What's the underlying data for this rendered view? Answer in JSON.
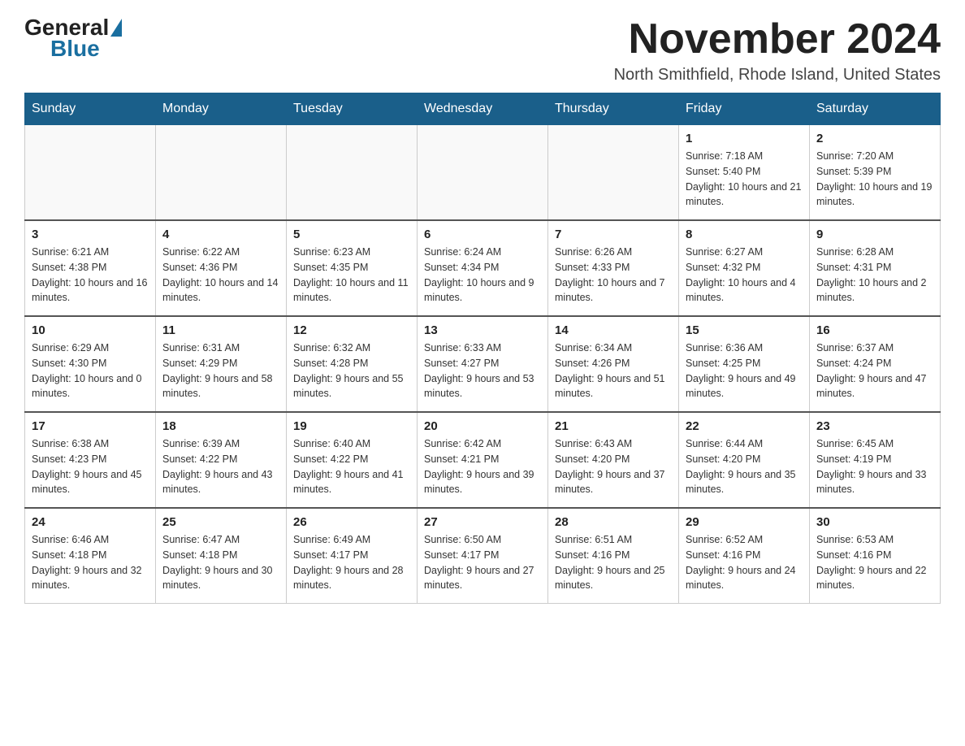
{
  "logo": {
    "general": "General",
    "blue": "Blue"
  },
  "title": "November 2024",
  "location": "North Smithfield, Rhode Island, United States",
  "days_of_week": [
    "Sunday",
    "Monday",
    "Tuesday",
    "Wednesday",
    "Thursday",
    "Friday",
    "Saturday"
  ],
  "weeks": [
    [
      {
        "day": "",
        "info": ""
      },
      {
        "day": "",
        "info": ""
      },
      {
        "day": "",
        "info": ""
      },
      {
        "day": "",
        "info": ""
      },
      {
        "day": "",
        "info": ""
      },
      {
        "day": "1",
        "info": "Sunrise: 7:18 AM\nSunset: 5:40 PM\nDaylight: 10 hours and 21 minutes."
      },
      {
        "day": "2",
        "info": "Sunrise: 7:20 AM\nSunset: 5:39 PM\nDaylight: 10 hours and 19 minutes."
      }
    ],
    [
      {
        "day": "3",
        "info": "Sunrise: 6:21 AM\nSunset: 4:38 PM\nDaylight: 10 hours and 16 minutes."
      },
      {
        "day": "4",
        "info": "Sunrise: 6:22 AM\nSunset: 4:36 PM\nDaylight: 10 hours and 14 minutes."
      },
      {
        "day": "5",
        "info": "Sunrise: 6:23 AM\nSunset: 4:35 PM\nDaylight: 10 hours and 11 minutes."
      },
      {
        "day": "6",
        "info": "Sunrise: 6:24 AM\nSunset: 4:34 PM\nDaylight: 10 hours and 9 minutes."
      },
      {
        "day": "7",
        "info": "Sunrise: 6:26 AM\nSunset: 4:33 PM\nDaylight: 10 hours and 7 minutes."
      },
      {
        "day": "8",
        "info": "Sunrise: 6:27 AM\nSunset: 4:32 PM\nDaylight: 10 hours and 4 minutes."
      },
      {
        "day": "9",
        "info": "Sunrise: 6:28 AM\nSunset: 4:31 PM\nDaylight: 10 hours and 2 minutes."
      }
    ],
    [
      {
        "day": "10",
        "info": "Sunrise: 6:29 AM\nSunset: 4:30 PM\nDaylight: 10 hours and 0 minutes."
      },
      {
        "day": "11",
        "info": "Sunrise: 6:31 AM\nSunset: 4:29 PM\nDaylight: 9 hours and 58 minutes."
      },
      {
        "day": "12",
        "info": "Sunrise: 6:32 AM\nSunset: 4:28 PM\nDaylight: 9 hours and 55 minutes."
      },
      {
        "day": "13",
        "info": "Sunrise: 6:33 AM\nSunset: 4:27 PM\nDaylight: 9 hours and 53 minutes."
      },
      {
        "day": "14",
        "info": "Sunrise: 6:34 AM\nSunset: 4:26 PM\nDaylight: 9 hours and 51 minutes."
      },
      {
        "day": "15",
        "info": "Sunrise: 6:36 AM\nSunset: 4:25 PM\nDaylight: 9 hours and 49 minutes."
      },
      {
        "day": "16",
        "info": "Sunrise: 6:37 AM\nSunset: 4:24 PM\nDaylight: 9 hours and 47 minutes."
      }
    ],
    [
      {
        "day": "17",
        "info": "Sunrise: 6:38 AM\nSunset: 4:23 PM\nDaylight: 9 hours and 45 minutes."
      },
      {
        "day": "18",
        "info": "Sunrise: 6:39 AM\nSunset: 4:22 PM\nDaylight: 9 hours and 43 minutes."
      },
      {
        "day": "19",
        "info": "Sunrise: 6:40 AM\nSunset: 4:22 PM\nDaylight: 9 hours and 41 minutes."
      },
      {
        "day": "20",
        "info": "Sunrise: 6:42 AM\nSunset: 4:21 PM\nDaylight: 9 hours and 39 minutes."
      },
      {
        "day": "21",
        "info": "Sunrise: 6:43 AM\nSunset: 4:20 PM\nDaylight: 9 hours and 37 minutes."
      },
      {
        "day": "22",
        "info": "Sunrise: 6:44 AM\nSunset: 4:20 PM\nDaylight: 9 hours and 35 minutes."
      },
      {
        "day": "23",
        "info": "Sunrise: 6:45 AM\nSunset: 4:19 PM\nDaylight: 9 hours and 33 minutes."
      }
    ],
    [
      {
        "day": "24",
        "info": "Sunrise: 6:46 AM\nSunset: 4:18 PM\nDaylight: 9 hours and 32 minutes."
      },
      {
        "day": "25",
        "info": "Sunrise: 6:47 AM\nSunset: 4:18 PM\nDaylight: 9 hours and 30 minutes."
      },
      {
        "day": "26",
        "info": "Sunrise: 6:49 AM\nSunset: 4:17 PM\nDaylight: 9 hours and 28 minutes."
      },
      {
        "day": "27",
        "info": "Sunrise: 6:50 AM\nSunset: 4:17 PM\nDaylight: 9 hours and 27 minutes."
      },
      {
        "day": "28",
        "info": "Sunrise: 6:51 AM\nSunset: 4:16 PM\nDaylight: 9 hours and 25 minutes."
      },
      {
        "day": "29",
        "info": "Sunrise: 6:52 AM\nSunset: 4:16 PM\nDaylight: 9 hours and 24 minutes."
      },
      {
        "day": "30",
        "info": "Sunrise: 6:53 AM\nSunset: 4:16 PM\nDaylight: 9 hours and 22 minutes."
      }
    ]
  ]
}
